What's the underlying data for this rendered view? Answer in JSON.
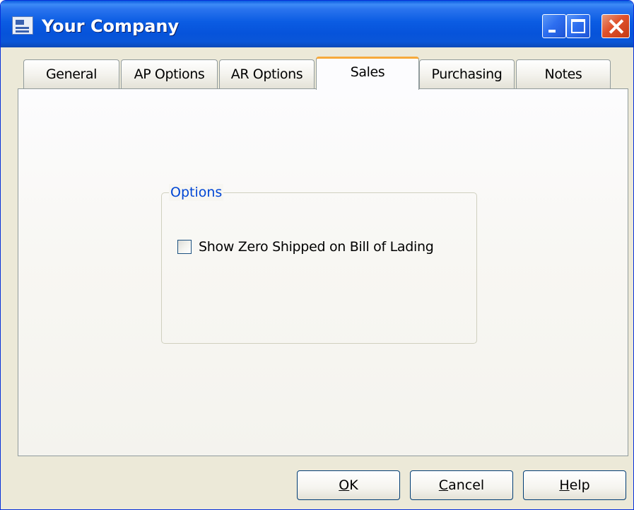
{
  "window": {
    "title": "Your Company",
    "title_icon": "company-window-icon",
    "controls": {
      "minimize_icon": "minimize-icon",
      "maximize_icon": "maximize-icon",
      "close_icon": "close-icon"
    }
  },
  "tabs": [
    {
      "label": "General",
      "active": false
    },
    {
      "label": "AP Options",
      "active": false
    },
    {
      "label": "AR Options",
      "active": false
    },
    {
      "label": "Sales",
      "active": true
    },
    {
      "label": "Purchasing",
      "active": false
    },
    {
      "label": "Notes",
      "active": false
    }
  ],
  "options_group": {
    "legend": "Options",
    "show_zero_shipped": {
      "label": "Show Zero Shipped on Bill of Lading",
      "checked": false
    }
  },
  "buttons": {
    "ok": {
      "accelerator": "O",
      "rest": "K"
    },
    "cancel": {
      "accelerator": "C",
      "rest": "ancel"
    },
    "help": {
      "accelerator": "H",
      "rest": "elp"
    }
  },
  "colors": {
    "titlebar": "#0b5ce3",
    "active_tab_accent": "#f7a93a",
    "group_legend": "#0046d5",
    "dialog_face": "#ece9d8"
  }
}
